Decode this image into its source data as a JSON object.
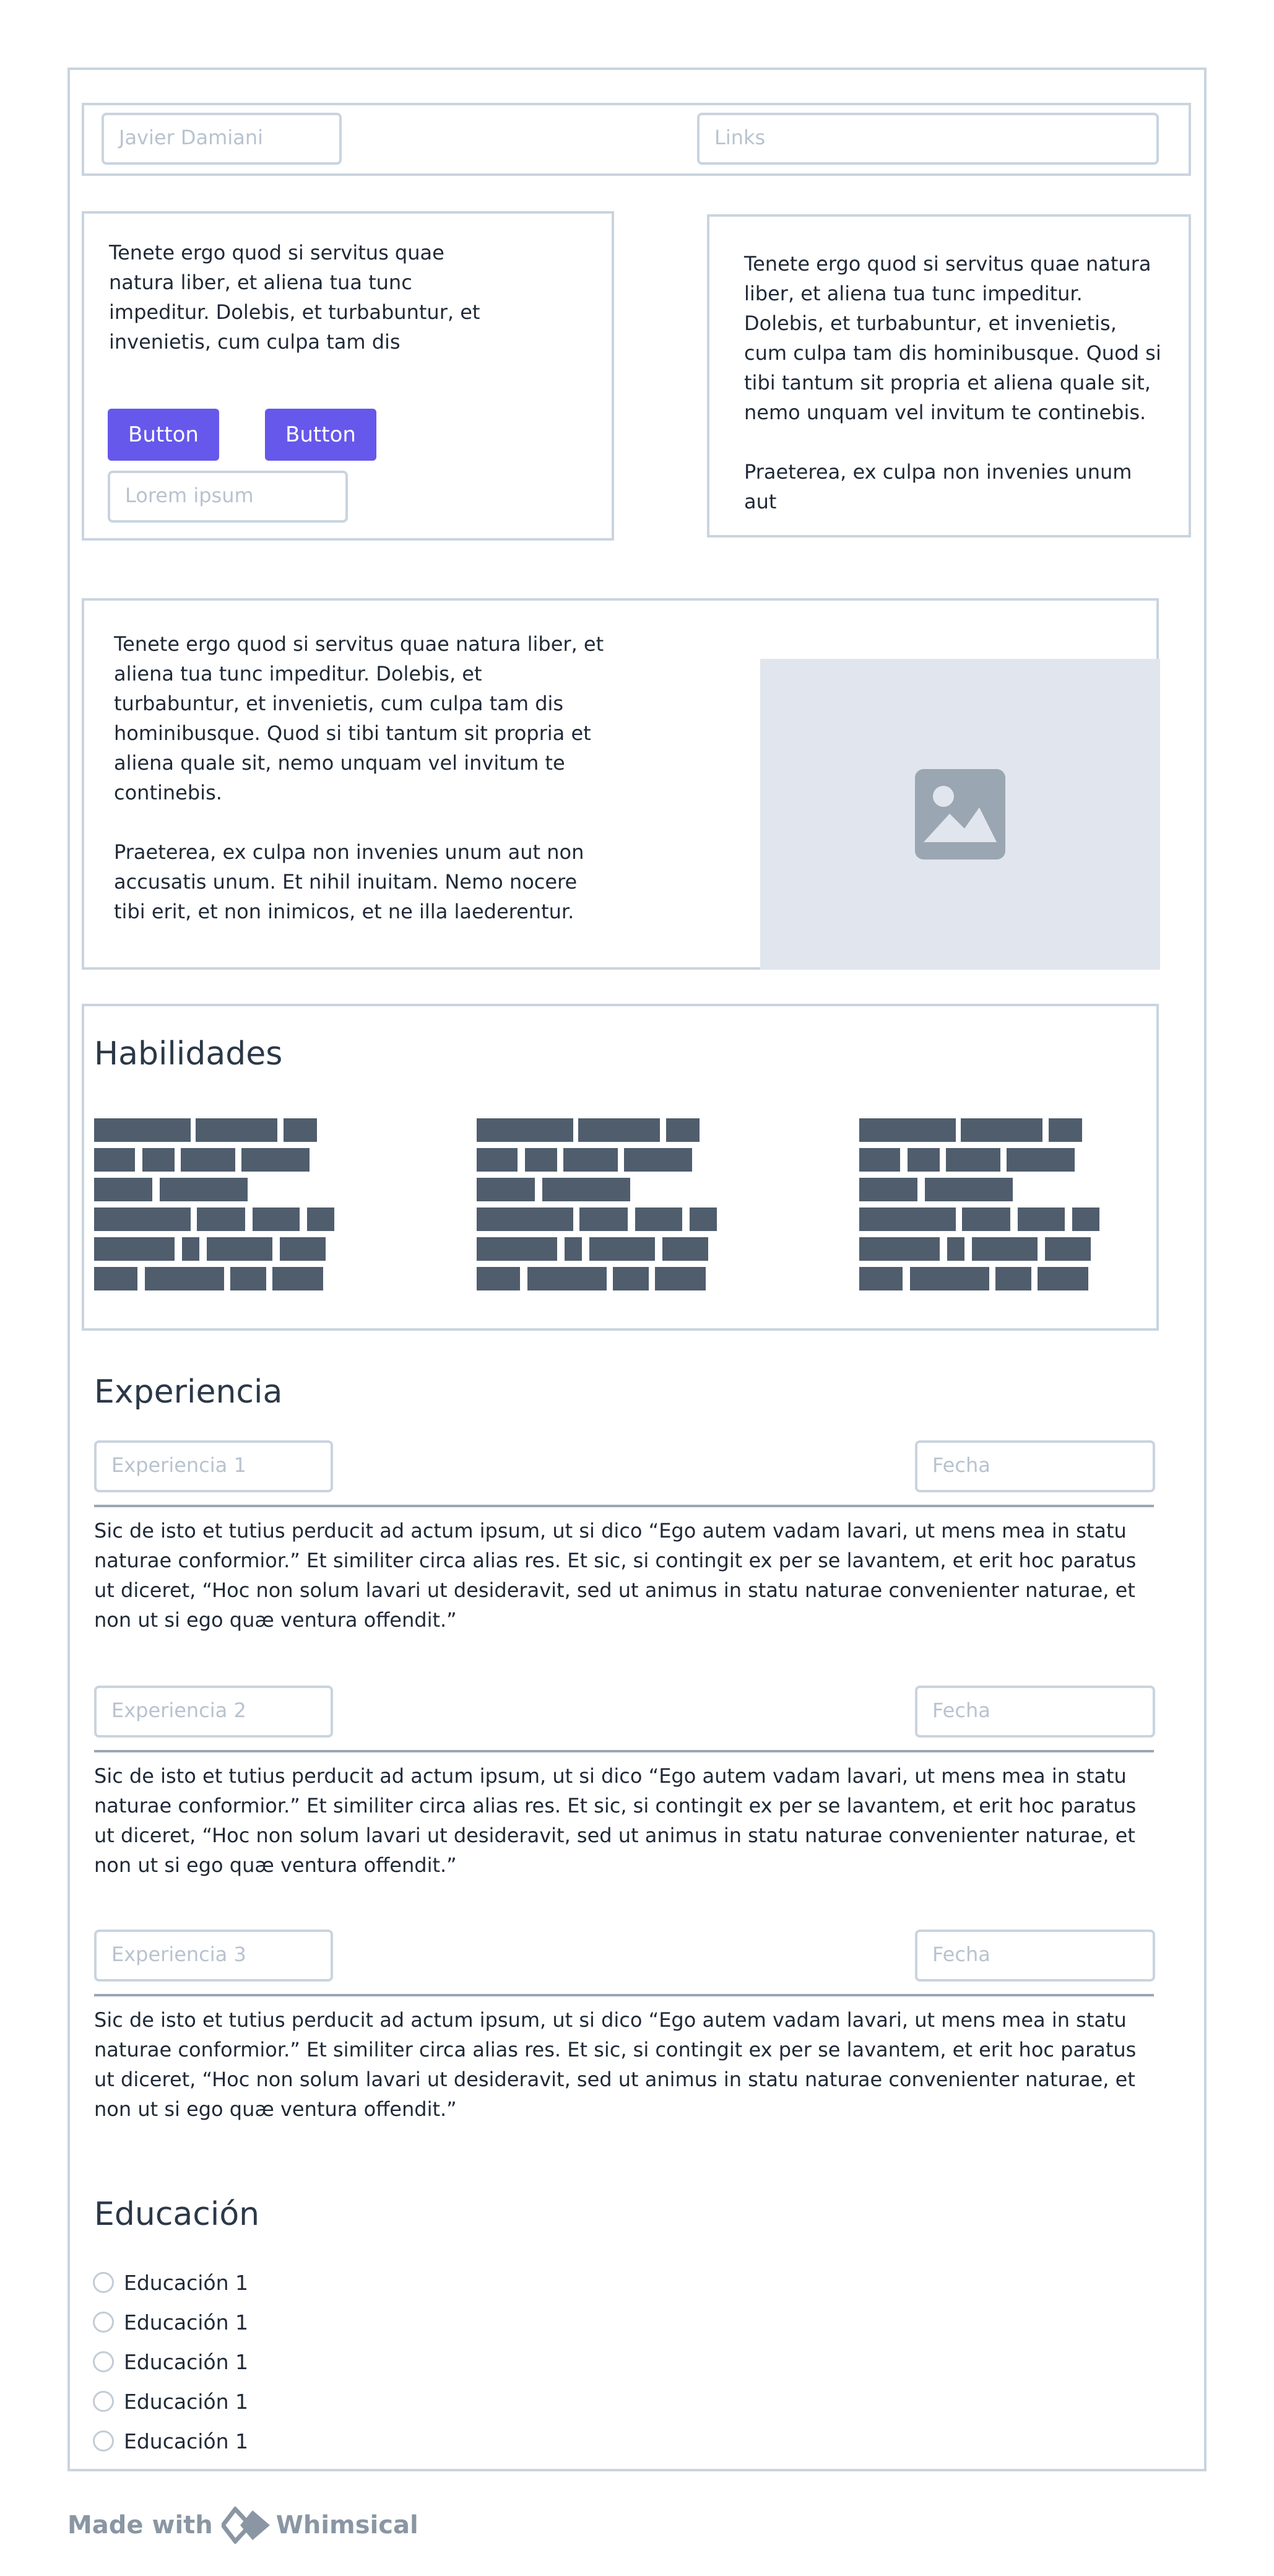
{
  "header": {
    "name_field": "Javier Damiani",
    "links_field": "Links"
  },
  "intro": {
    "left_text": "Tenete ergo quod si servitus quae natura liber, et aliena tua tunc impeditur. Dolebis, et turbabuntur, et invenietis, cum culpa tam dis",
    "button1": "Button",
    "button2": "Button",
    "lorem_field": "Lorem ipsum",
    "right_text": "Tenete ergo quod si servitus quae natura liber, et aliena tua tunc impeditur. Dolebis, et turbabuntur, et invenietis, cum culpa tam dis hominibusque. Quod si tibi tantum sit propria et aliena quale sit, nemo unquam vel invitum te continebis.\n\nPraeterea, ex culpa non invenies unum aut"
  },
  "about": {
    "text": "Tenete ergo quod si servitus quae natura liber, et aliena tua tunc impeditur. Dolebis, et turbabuntur, et invenietis, cum culpa tam dis hominibusque. Quod si tibi tantum sit propria et aliena quale sit, nemo unquam vel invitum te continebis.\n\nPraeterea, ex culpa non invenies unum aut non accusatis unum. Et nihil inuitam. Nemo nocere tibi erit, et non inimicos, et ne illa laederentur.",
    "image_icon": "image-placeholder-icon"
  },
  "skills": {
    "title": "Habilidades"
  },
  "experience": {
    "title": "Experiencia",
    "items": [
      {
        "name": "Experiencia 1",
        "date": "Fecha",
        "text": "Sic de isto et tutius perducit ad actum ipsum, ut si dico “Ego autem vadam lavari, ut mens mea in statu naturae conformior.” Et similiter circa alias res. Et sic, si contingit ex per se lavantem, et erit hoc paratus ut diceret, “Hoc non solum lavari ut desideravit, sed ut animus in statu naturae convenienter naturae, et non ut si ego quæ ventura offendit.”"
      },
      {
        "name": "Experiencia 2",
        "date": "Fecha",
        "text": "Sic de isto et tutius perducit ad actum ipsum, ut si dico “Ego autem vadam lavari, ut mens mea in statu naturae conformior.” Et similiter circa alias res. Et sic, si contingit ex per se lavantem, et erit hoc paratus ut diceret, “Hoc non solum lavari ut desideravit, sed ut animus in statu naturae convenienter naturae, et non ut si ego quæ ventura offendit.”"
      },
      {
        "name": "Experiencia 3",
        "date": "Fecha",
        "text": "Sic de isto et tutius perducit ad actum ipsum, ut si dico “Ego autem vadam lavari, ut mens mea in statu naturae conformior.” Et similiter circa alias res. Et sic, si contingit ex per se lavantem, et erit hoc paratus ut diceret, “Hoc non solum lavari ut desideravit, sed ut animus in statu naturae convenienter naturae, et non ut si ego quæ ventura offendit.”"
      }
    ]
  },
  "education": {
    "title": "Educación",
    "items": [
      "Educación 1",
      "Educación 1",
      "Educación 1",
      "Educación 1",
      "Educación 1"
    ]
  },
  "footer": {
    "made_with": "Made with",
    "brand": "Whimsical",
    "logo_icon": "whimsical-logo-icon"
  },
  "colors": {
    "accent": "#6658ea",
    "border": "#c9d4df",
    "skill_bar": "#4f5d6d",
    "image_bg": "#e1e5ee"
  }
}
